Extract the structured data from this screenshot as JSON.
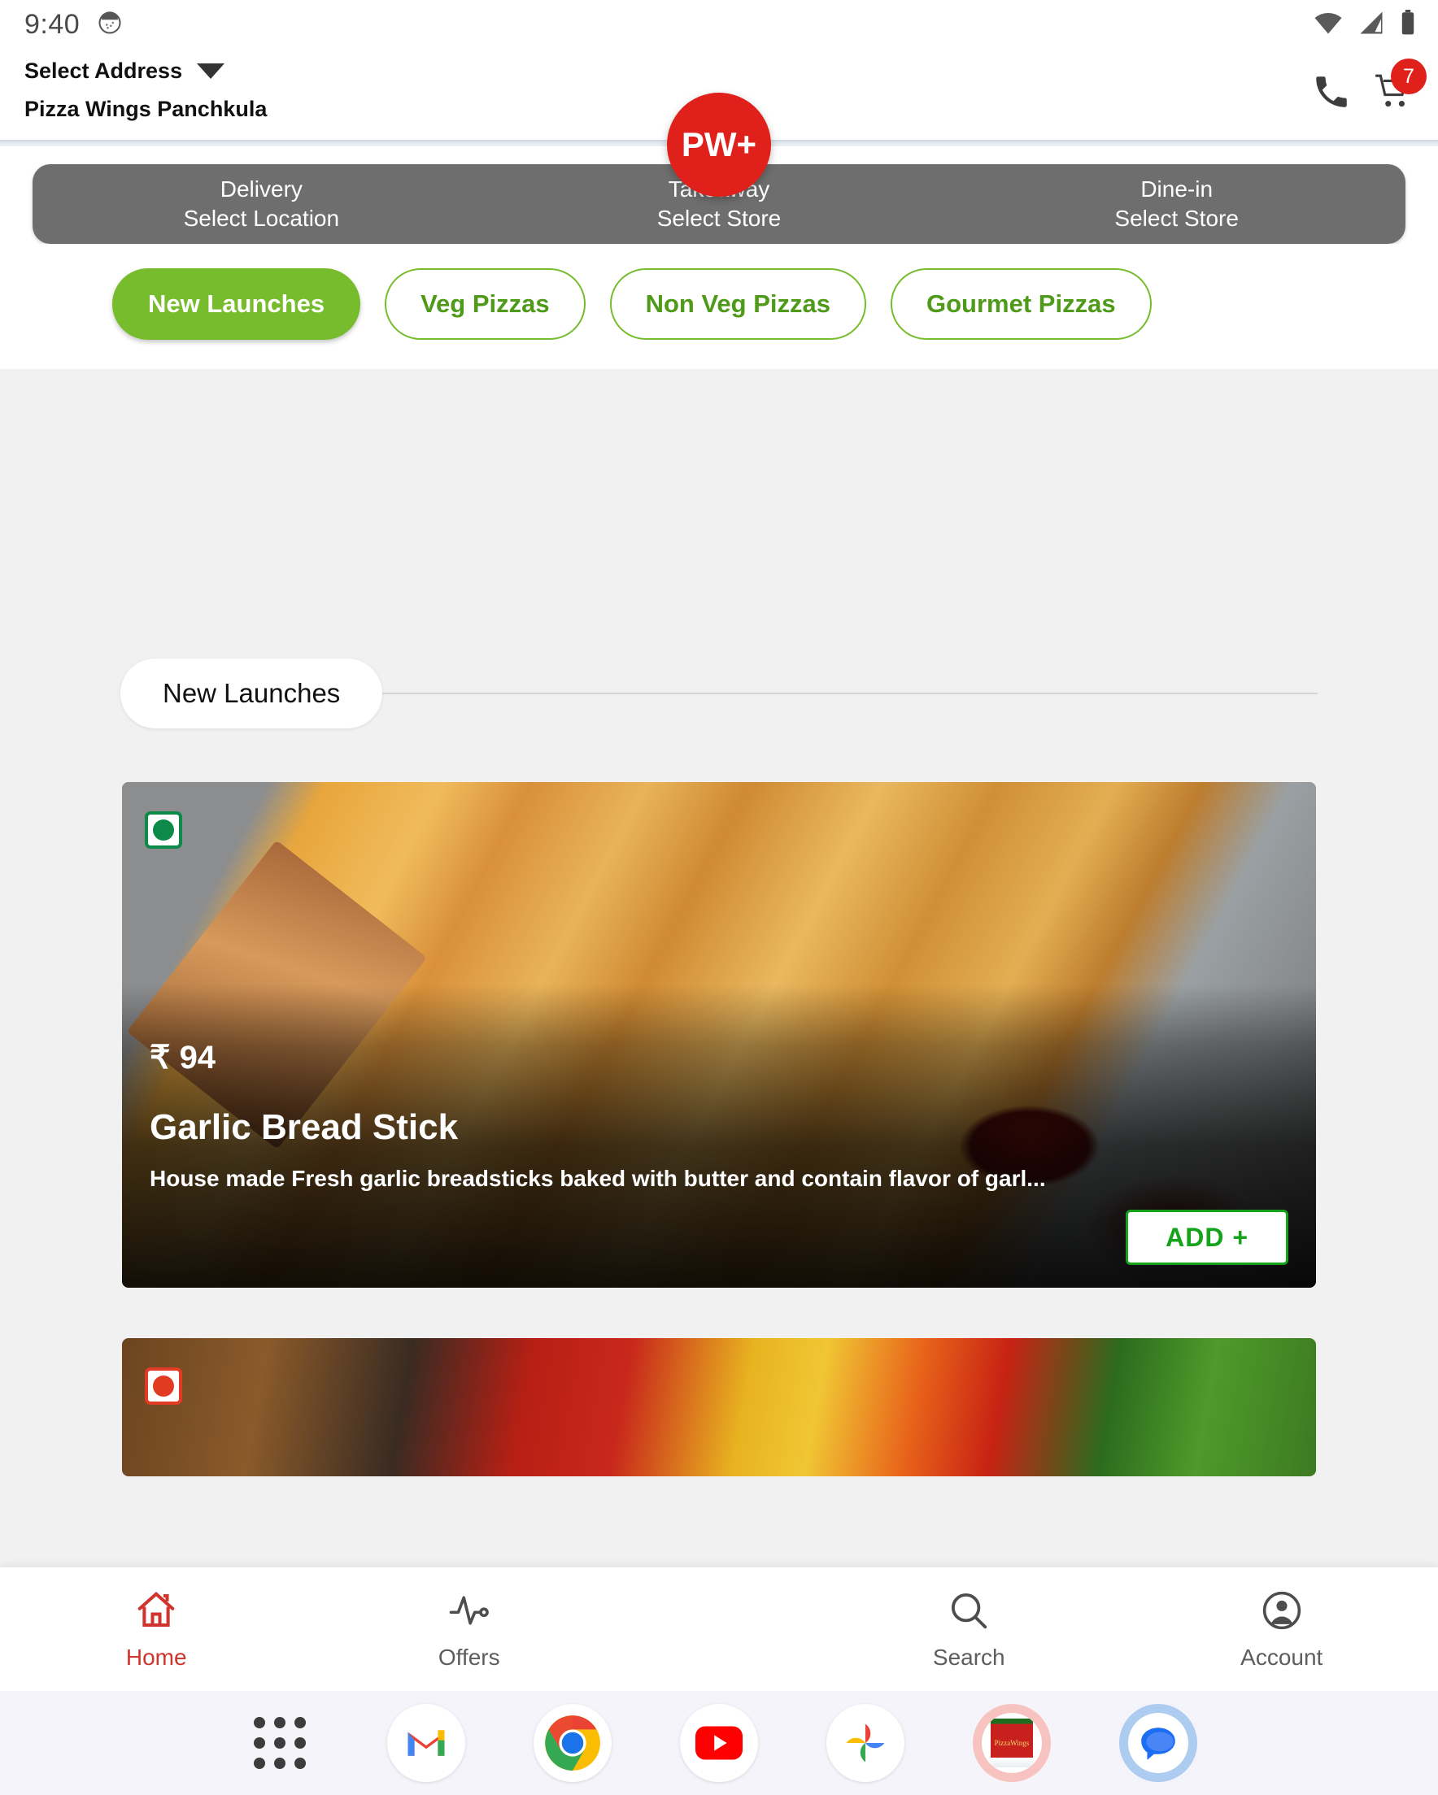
{
  "status_bar": {
    "time": "9:40",
    "icons": [
      "camera-icon",
      "wifi-icon",
      "signal-icon",
      "battery-icon"
    ]
  },
  "header": {
    "address_label": "Select Address",
    "store_name": "Pizza Wings Panchkula",
    "phone_icon": "phone-icon",
    "cart_icon": "cart-icon",
    "cart_count": "7"
  },
  "service_tabs": [
    {
      "title": "Delivery",
      "subtitle": "Select Location"
    },
    {
      "title": "Takeaway",
      "subtitle": "Select Store"
    },
    {
      "title": "Dine-in",
      "subtitle": "Select Store"
    }
  ],
  "categories": [
    {
      "label": "New Launches",
      "active": true
    },
    {
      "label": "Veg Pizzas",
      "active": false
    },
    {
      "label": "Non Veg Pizzas",
      "active": false
    },
    {
      "label": "Gourmet Pizzas",
      "active": false
    }
  ],
  "section": {
    "title": "New Launches"
  },
  "products": [
    {
      "price": "₹ 94",
      "name": "Garlic Bread Stick",
      "description": "House made Fresh garlic breadsticks baked with butter and contain flavor of garl...",
      "add_label": "ADD +",
      "diet": "veg"
    },
    {
      "diet": "nonveg"
    }
  ],
  "bottom_nav": {
    "items": [
      {
        "label": "Home",
        "icon": "home-icon",
        "active": true
      },
      {
        "label": "Offers",
        "icon": "pulse-icon",
        "active": false
      },
      {
        "label": "Search",
        "icon": "search-icon",
        "active": false
      },
      {
        "label": "Account",
        "icon": "account-icon",
        "active": false
      }
    ],
    "fab_label": "PW+"
  },
  "dock": {
    "items": [
      {
        "name": "app-drawer"
      },
      {
        "name": "gmail"
      },
      {
        "name": "chrome"
      },
      {
        "name": "youtube"
      },
      {
        "name": "google-photos"
      },
      {
        "name": "pizza-wings",
        "text": "PizzaWings"
      },
      {
        "name": "google-messages"
      }
    ]
  },
  "colors": {
    "brand_red": "#e0201b",
    "brand_green": "#76bc2d",
    "add_green": "#16a31c",
    "service_gray": "#6e6e6e"
  }
}
